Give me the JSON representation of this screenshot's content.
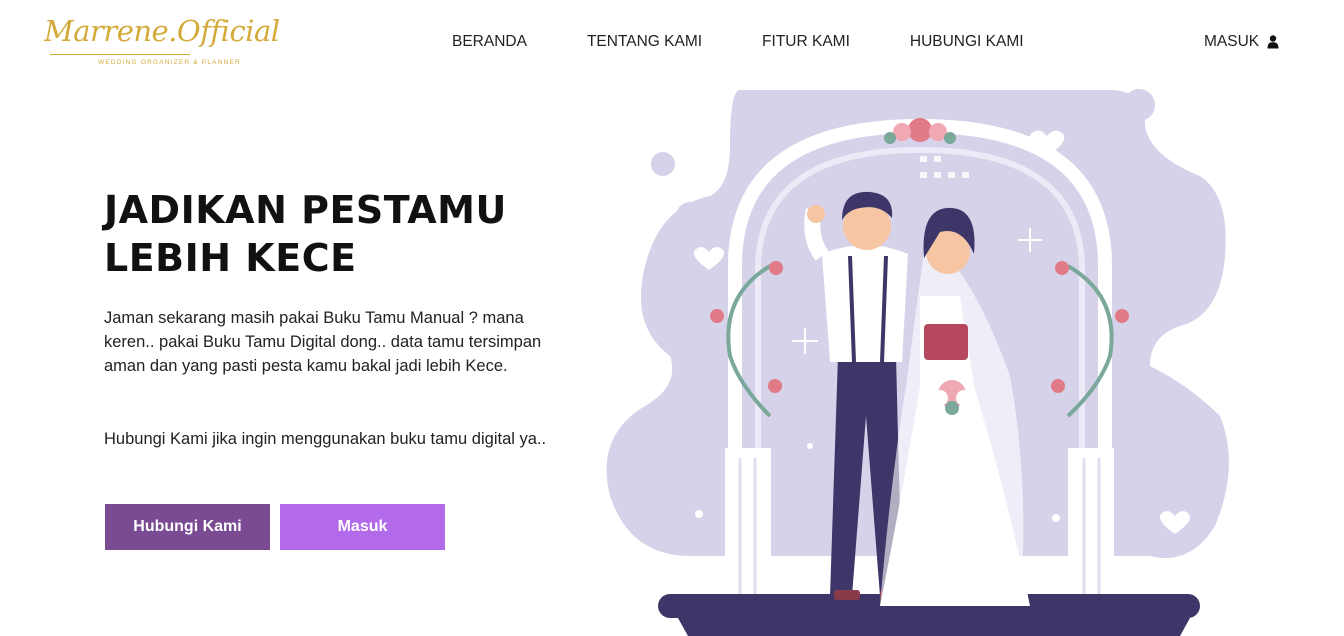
{
  "brand": {
    "name": "Marrene.Official",
    "tagline": "WEDDING ORGANIZER & PLANNER",
    "color": "#d4aa3a"
  },
  "nav": {
    "items": [
      {
        "label": "BERANDA"
      },
      {
        "label": "TENTANG KAMI"
      },
      {
        "label": "FITUR KAMI"
      },
      {
        "label": "HUBUNGI KAMI"
      }
    ],
    "login_label": "MASUK",
    "login_icon": "user-icon"
  },
  "hero": {
    "title_line1": "JADIKAN PESTAMU",
    "title_line2": "LEBIH KECE",
    "description": "Jaman sekarang masih pakai Buku Tamu Manual ? mana keren.. pakai Buku Tamu Digital dong.. data tamu tersimpan aman dan yang pasti pesta kamu bakal jadi lebih Kece.",
    "contact_text": "Hubungi Kami jika ingin menggunakan buku tamu digital ya..",
    "button_contact": "Hubungi Kami",
    "button_login": "Masuk"
  },
  "colors": {
    "button_contact": "#7a4a93",
    "button_login": "#b26aea",
    "illustration_bg": "#d6d2ea",
    "ground": "#3e3668"
  }
}
